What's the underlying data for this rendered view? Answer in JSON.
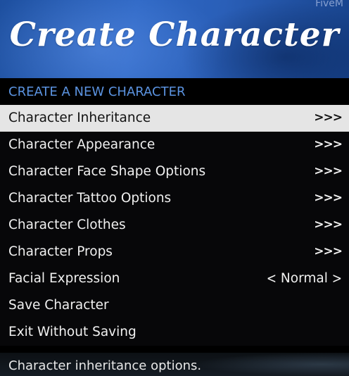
{
  "watermark": "FiveM",
  "banner": {
    "title": "Create Character"
  },
  "subtitle": "CREATE A NEW CHARACTER",
  "menu": {
    "items": [
      {
        "label": "Character Inheritance",
        "suffix": ">>>",
        "selected": true
      },
      {
        "label": "Character Appearance",
        "suffix": ">>>"
      },
      {
        "label": "Character Face Shape Options",
        "suffix": ">>>"
      },
      {
        "label": "Character Tattoo Options",
        "suffix": ">>>"
      },
      {
        "label": "Character Clothes",
        "suffix": ">>>"
      },
      {
        "label": "Character Props",
        "suffix": ">>>"
      },
      {
        "label": "Facial Expression",
        "value": "Normal",
        "left_chevron": "<",
        "right_chevron": ">"
      },
      {
        "label": "Save Character"
      },
      {
        "label": "Exit Without Saving"
      }
    ]
  },
  "description": "Character inheritance options.",
  "colors": {
    "banner_blue": "#2d66c3",
    "subtitle_blue": "#5b93e0",
    "selected_bg": "#e5e5e5",
    "menu_bg": "#08080a"
  }
}
